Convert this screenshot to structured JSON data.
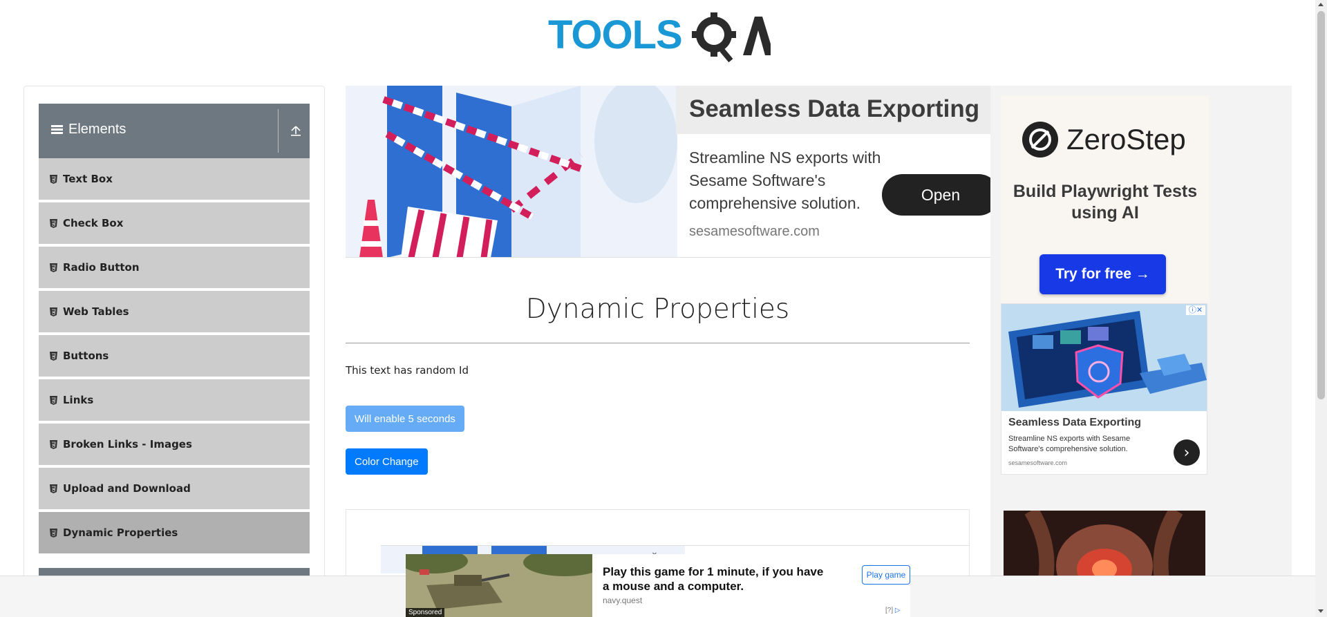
{
  "header": {
    "logo_text": "TOOLSQA",
    "logo_visible_word": "TOOLS"
  },
  "sidebar": {
    "group_title": "Elements",
    "items": [
      {
        "label": "Text Box"
      },
      {
        "label": "Check Box"
      },
      {
        "label": "Radio Button"
      },
      {
        "label": "Web Tables"
      },
      {
        "label": "Buttons"
      },
      {
        "label": "Links"
      },
      {
        "label": "Broken Links - Images"
      },
      {
        "label": "Upload and Download"
      },
      {
        "label": "Dynamic Properties",
        "active": true
      }
    ]
  },
  "banner_ad": {
    "headline": "Seamless Data Exporting",
    "body": "Streamline NS exports with Sesame Software's comprehensive solution.",
    "domain": "sesamesoftware.com",
    "cta": "Open"
  },
  "main": {
    "title": "Dynamic Properties",
    "random_text": "This text has random Id",
    "disabled_button": "Will enable 5 seconds",
    "color_button": "Color Change"
  },
  "right_ad": {
    "brand": "ZeroStep",
    "subtitle": "Build Playwright Tests using AI",
    "cta": "Try for free →",
    "card_title": "Seamless Data Exporting",
    "card_body": "Streamline NS exports with Sesame Software's comprehensive solution.",
    "card_domain": "sesamesoftware.com",
    "card_go": "›"
  },
  "sticky_ad": {
    "headline": "Play this game for 1 minute, if you have a mouse and a computer.",
    "domain": "navy.quest",
    "cta": "Play game",
    "sponsored": "Sponsored",
    "info": "[?]"
  },
  "colors": {
    "brand_blue": "#1a98d5",
    "sidebar_header": "#6e7881",
    "menu_item": "#cccccc",
    "menu_active": "#b0b0b0",
    "primary": "#007bff",
    "primary_disabled": "#5da7f6",
    "zerostep_button": "#1739e6"
  }
}
